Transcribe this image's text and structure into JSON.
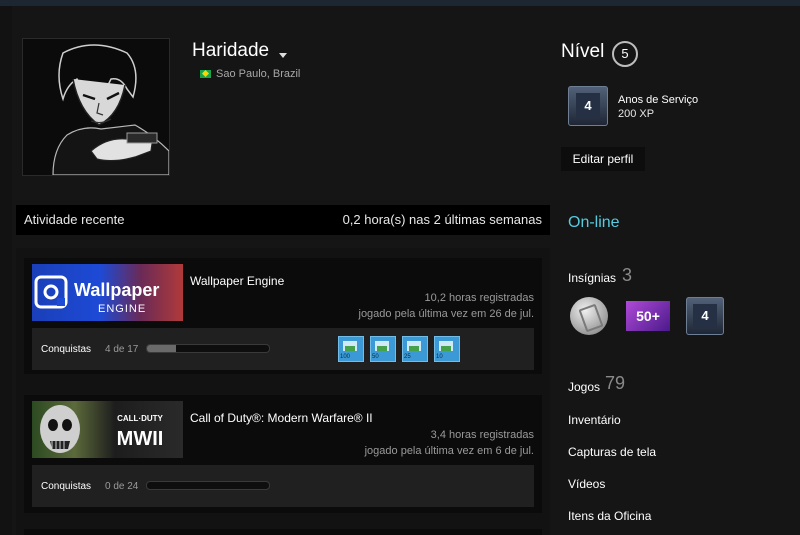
{
  "profile": {
    "name": "Haridade",
    "location": "Sao Paulo, Brazil"
  },
  "level": {
    "label": "Nível",
    "value": "5",
    "service_badge_value": "4",
    "service_title": "Anos de Serviço",
    "service_xp": "200 XP",
    "edit_label": "Editar perfil"
  },
  "activity": {
    "title": "Atividade recente",
    "hours_summary": "0,2 hora(s) nas 2 últimas semanas",
    "games": [
      {
        "name": "Wallpaper Engine",
        "capsule_text": "Wallpaper",
        "capsule_subtext": "ENGINE",
        "hours": "10,2 horas registradas",
        "last_played": "jogado pela última vez em 26 de jul.",
        "achievements_label": "Conquistas",
        "achievements_count": "4 de 17",
        "achievements_progress": 0.235,
        "achievement_icons": [
          "100",
          "50",
          "25",
          "10"
        ]
      },
      {
        "name": "Call of Duty®: Modern Warfare® II",
        "capsule_text": "CALL·DUTY",
        "capsule_subtext": "MWII",
        "hours": "3,4 horas registradas",
        "last_played": "jogado pela última vez em 6 de jul.",
        "achievements_label": "Conquistas",
        "achievements_count": "0 de 24",
        "achievements_progress": 0
      }
    ]
  },
  "sidebar": {
    "status": "On-line",
    "badges_label": "Insígnias",
    "badges_count": "3",
    "badge_50_label": "50+",
    "badge_years_value": "4",
    "games_label": "Jogos",
    "games_count": "79",
    "links": [
      "Inventário",
      "Capturas de tela",
      "Vídeos",
      "Itens da Oficina"
    ]
  },
  "colors": {
    "online": "#57cbde",
    "background": "#121212"
  }
}
